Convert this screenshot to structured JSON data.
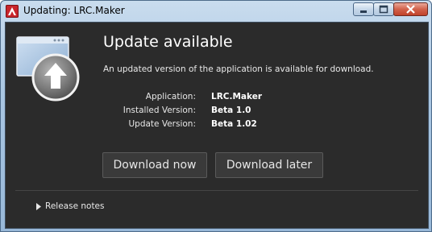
{
  "window": {
    "title": "Updating: LRC.Maker",
    "app_icon": "adobe-air-icon",
    "controls": {
      "minimize": "minimize-icon",
      "maximize": "maximize-icon",
      "close": "close-icon"
    }
  },
  "main": {
    "hero_icon": "update-arrow-up-icon",
    "heading": "Update available",
    "description": "An updated version of the application is available for download.",
    "info": [
      {
        "label": "Application:",
        "value": "LRC.Maker"
      },
      {
        "label": "Installed Version:",
        "value": "Beta 1.0"
      },
      {
        "label": "Update Version:",
        "value": "Beta 1.02"
      }
    ],
    "buttons": {
      "download_now": "Download now",
      "download_later": "Download later"
    },
    "release_notes": {
      "label": "Release notes",
      "icon": "triangle-right-icon"
    }
  },
  "colors": {
    "background": "#2b2b2b",
    "text": "#e8e8e8",
    "button_bg": "#3a3a3a",
    "title_bar": "#b6cde6",
    "close_button": "#c8503a"
  }
}
